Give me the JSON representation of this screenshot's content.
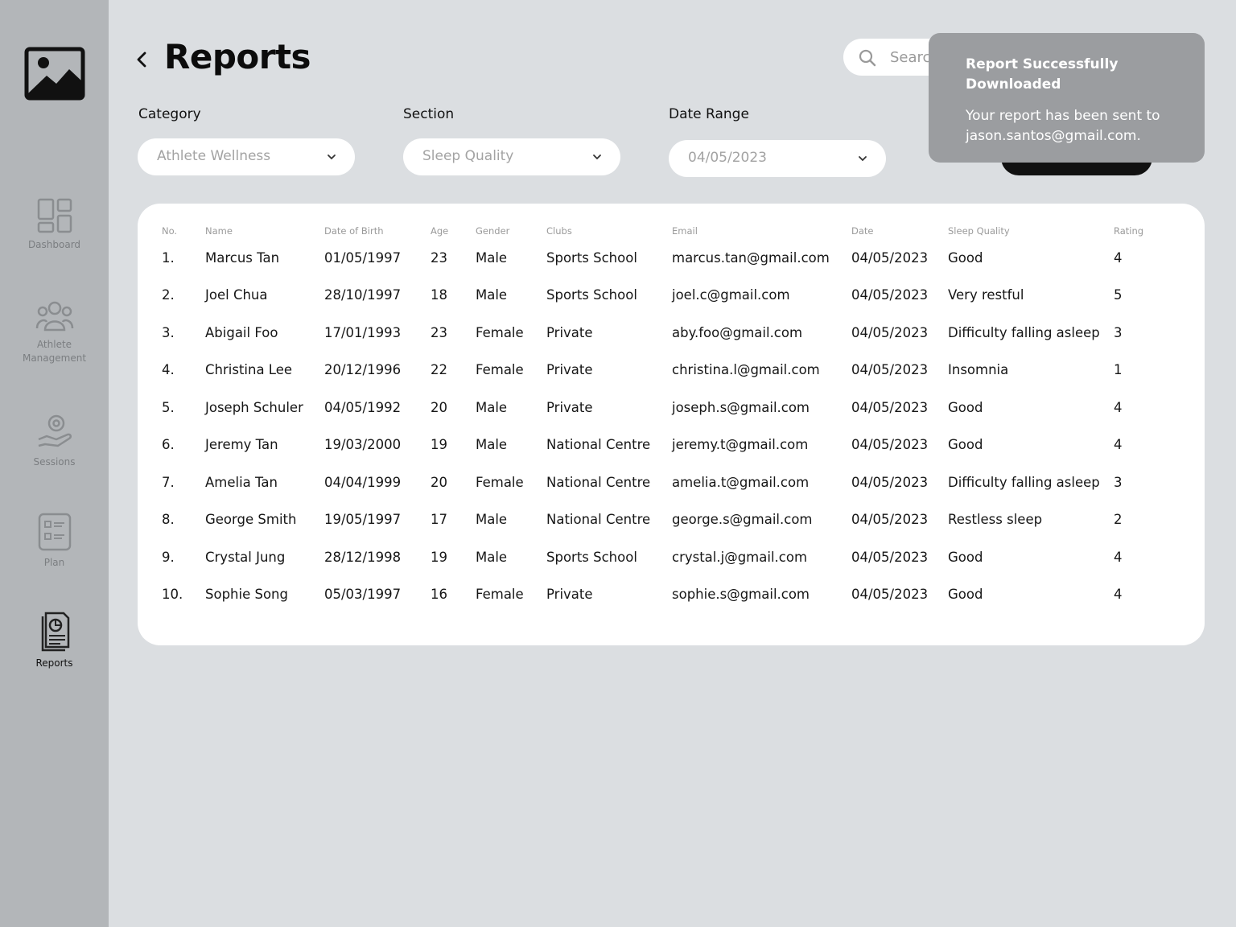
{
  "sidebar": {
    "items": [
      {
        "label": "Dashboard",
        "icon": "dashboard-icon"
      },
      {
        "label": "Athlete Management",
        "icon": "athletes-icon"
      },
      {
        "label": "Sessions",
        "icon": "sessions-icon"
      },
      {
        "label": "Plan",
        "icon": "plan-icon"
      },
      {
        "label": "Reports",
        "icon": "reports-icon",
        "active": true
      }
    ]
  },
  "header": {
    "title": "Reports",
    "search_placeholder": "Search"
  },
  "filters": {
    "category": {
      "label": "Category",
      "value": "Athlete Wellness"
    },
    "section": {
      "label": "Section",
      "value": "Sleep Quality"
    },
    "date_range": {
      "label": "Date Range",
      "value": "04/05/2023"
    }
  },
  "table": {
    "columns": [
      "No.",
      "Name",
      "Date of Birth",
      "Age",
      "Gender",
      "Clubs",
      "Email",
      "Date",
      "Sleep Quality",
      "Rating"
    ],
    "rows": [
      [
        "1.",
        "Marcus Tan",
        "01/05/1997",
        "23",
        "Male",
        "Sports School",
        "marcus.tan@gmail.com",
        "04/05/2023",
        "Good",
        "4"
      ],
      [
        "2.",
        "Joel Chua",
        "28/10/1997",
        "18",
        "Male",
        "Sports School",
        "joel.c@gmail.com",
        "04/05/2023",
        "Very restful",
        "5"
      ],
      [
        "3.",
        "Abigail Foo",
        "17/01/1993",
        "23",
        "Female",
        "Private",
        "aby.foo@gmail.com",
        "04/05/2023",
        "Difficulty falling asleep",
        "3"
      ],
      [
        "4.",
        "Christina Lee",
        "20/12/1996",
        "22",
        "Female",
        "Private",
        "christina.l@gmail.com",
        "04/05/2023",
        "Insomnia",
        "1"
      ],
      [
        "5.",
        "Joseph Schuler",
        "04/05/1992",
        "20",
        "Male",
        "Private",
        "joseph.s@gmail.com",
        "04/05/2023",
        "Good",
        "4"
      ],
      [
        "6.",
        "Jeremy Tan",
        "19/03/2000",
        "19",
        "Male",
        "National Centre",
        "jeremy.t@gmail.com",
        "04/05/2023",
        "Good",
        "4"
      ],
      [
        "7.",
        "Amelia Tan",
        "04/04/1999",
        "20",
        "Female",
        "National Centre",
        "amelia.t@gmail.com",
        "04/05/2023",
        "Difficulty falling asleep",
        "3"
      ],
      [
        "8.",
        "George Smith",
        "19/05/1997",
        "17",
        "Male",
        "National Centre",
        "george.s@gmail.com",
        "04/05/2023",
        "Restless sleep",
        "2"
      ],
      [
        "9.",
        "Crystal Jung",
        "28/12/1998",
        "19",
        "Male",
        "Sports School",
        "crystal.j@gmail.com",
        "04/05/2023",
        "Good",
        "4"
      ],
      [
        "10.",
        "Sophie Song",
        "05/03/1997",
        "16",
        "Female",
        "Private",
        "sophie.s@gmail.com",
        "04/05/2023",
        "Good",
        "4"
      ]
    ]
  },
  "toast": {
    "title": "Report Successfully Downloaded",
    "message": "Your report has been sent to jason.santos@gmail.com."
  },
  "colors": {
    "background": "#dbdee1",
    "sidebar": "#b3b6b9",
    "toast": "#9b9da0",
    "card": "#ffffff"
  }
}
